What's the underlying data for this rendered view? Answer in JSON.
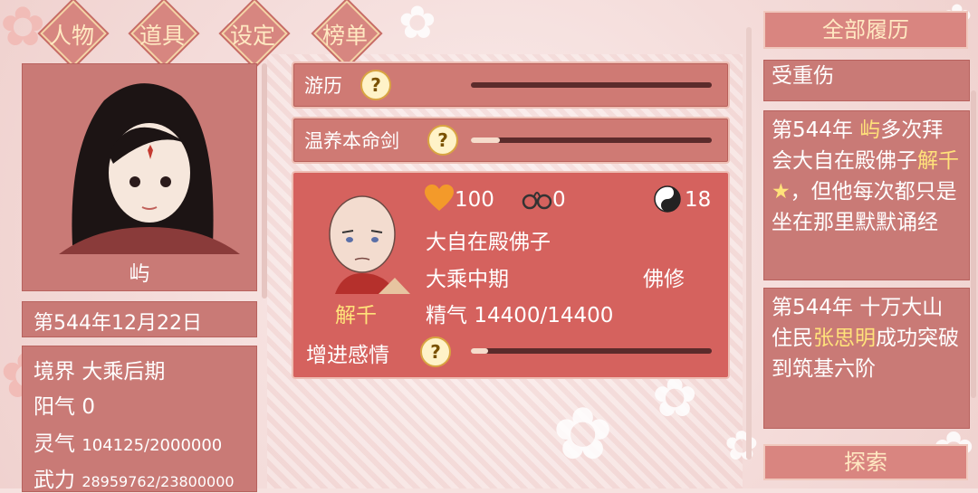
{
  "nav": {
    "tabs": [
      "人物",
      "道具",
      "设定",
      "榜单"
    ]
  },
  "character": {
    "name": "屿",
    "date": "第544年12月22日",
    "stats": [
      {
        "label": "境界",
        "value": "大乘后期"
      },
      {
        "label": "阳气",
        "value": "0"
      },
      {
        "label": "灵气",
        "value": "104125/2000000"
      },
      {
        "label": "武力",
        "value": "28959762/23800000"
      }
    ]
  },
  "activities": [
    {
      "label": "游历",
      "progress": 0
    },
    {
      "label": "温养本命剑",
      "progress": 0.12
    }
  ],
  "npc": {
    "name": "解千",
    "affection": "100",
    "bond": "0",
    "yinyang": "18",
    "title": "大自在殿佛子",
    "realm": "大乘中期",
    "sect": "佛修",
    "essence_label": "精气",
    "essence_value": "14400/14400",
    "action_label": "增进感情",
    "action_progress": 0.07,
    "qmark": "?"
  },
  "history": {
    "title": "全部履历",
    "partial": "受重伤",
    "entries": [
      {
        "parts": [
          {
            "t": "第544年 "
          },
          {
            "t": "屿",
            "hl": true
          },
          {
            "t": "多次拜会大自在殿佛子"
          },
          {
            "t": "解千★",
            "hl": true
          },
          {
            "t": "，但他每次都只是坐在那里默默诵经"
          }
        ]
      },
      {
        "parts": [
          {
            "t": "第544年 十万大山住民"
          },
          {
            "t": "张思明",
            "hl": true
          },
          {
            "t": "成功突破到筑基六阶"
          }
        ]
      }
    ],
    "explore": "探索"
  },
  "colors": {
    "panel": "#c97a76",
    "highlight": "#ffe27a",
    "tab_text": "#ffe9c2",
    "heart": "#f39a2a"
  },
  "icons": [
    "heart-icon",
    "handcuffs-icon",
    "yinyang-icon",
    "question-icon",
    "flower-icon"
  ]
}
